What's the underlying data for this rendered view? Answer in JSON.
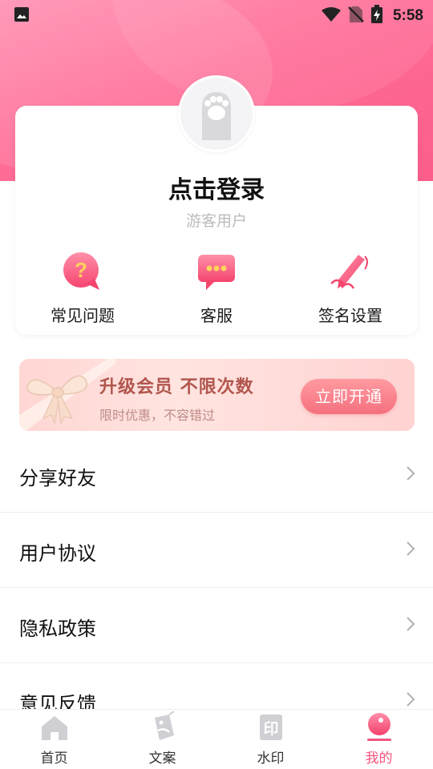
{
  "status_bar": {
    "time": "5:58",
    "icons": [
      "gallery-icon",
      "wifi-icon",
      "no-sim-icon",
      "battery-charging-icon"
    ]
  },
  "profile": {
    "avatar_icon": "cat-paw-icon",
    "login_title": "点击登录",
    "guest_label": "游客用户"
  },
  "quick_actions": [
    {
      "label": "常见问题",
      "icon": "question-bubble-icon"
    },
    {
      "label": "客服",
      "icon": "chat-bubble-icon"
    },
    {
      "label": "签名设置",
      "icon": "signature-pen-icon"
    }
  ],
  "vip_banner": {
    "title": "升级会员 不限次数",
    "subtitle": "限时优惠，不容错过",
    "button_label": "立即开通",
    "icon": "gift-bow-icon"
  },
  "menu": [
    {
      "label": "分享好友"
    },
    {
      "label": "用户协议"
    },
    {
      "label": "隐私政策"
    },
    {
      "label": "意见反馈"
    }
  ],
  "tab_bar": [
    {
      "label": "首页",
      "icon": "home-icon",
      "active": false
    },
    {
      "label": "文案",
      "icon": "copywriting-icon",
      "active": false
    },
    {
      "label": "水印",
      "icon": "watermark-icon",
      "active": false
    },
    {
      "label": "我的",
      "icon": "profile-icon",
      "active": true
    }
  ],
  "colors": {
    "header_pink": "#ff6d97",
    "accent": "#f2557e",
    "vip_button": "#f5707f",
    "vip_text": "#b1564e"
  }
}
